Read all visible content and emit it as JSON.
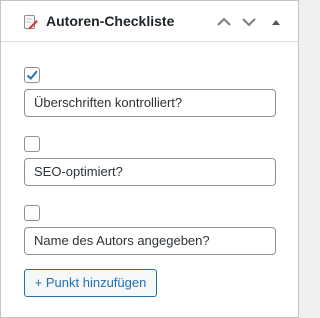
{
  "panel": {
    "title": "Autoren-Checkliste",
    "icon": "edit-page-icon",
    "controls": [
      "move-up-icon",
      "move-down-icon",
      "toggle-panel-icon"
    ]
  },
  "checklist": [
    {
      "checked": true,
      "value": "Überschriften kontrolliert?"
    },
    {
      "checked": false,
      "value": "SEO-optimiert?"
    },
    {
      "checked": false,
      "value": "Name des Autors angegeben?"
    }
  ],
  "add_button_label": "+ Punkt hinzufügen",
  "colors": {
    "accent": "#2271b1",
    "border": "#8c8f94",
    "icon_red": "#d63638"
  }
}
